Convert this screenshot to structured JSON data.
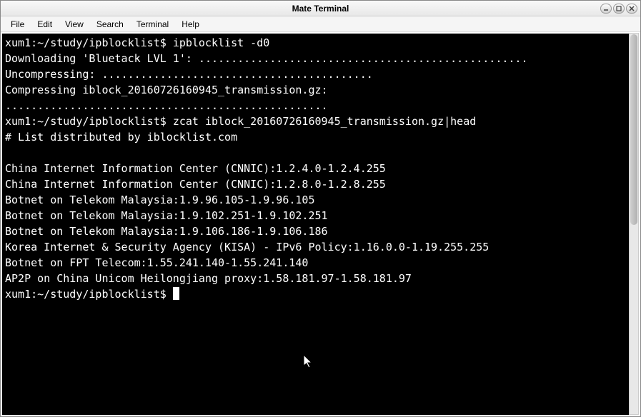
{
  "window": {
    "title": "Mate Terminal"
  },
  "menu": {
    "file": "File",
    "edit": "Edit",
    "view": "View",
    "search": "Search",
    "terminal": "Terminal",
    "help": "Help"
  },
  "terminal": {
    "prompt1": "xum1:~/study/ipblocklist$ ",
    "cmd1": "ipblocklist -d0",
    "line_download": "Downloading 'Bluetack LVL 1': ...................................................",
    "line_uncompress": "Uncompressing: ..........................................",
    "line_compress": "Compressing iblock_20160726160945_transmission.gz: ..................................................",
    "prompt2": "xum1:~/study/ipblocklist$ ",
    "cmd2": "zcat iblock_20160726160945_transmission.gz|head",
    "out1": "# List distributed by iblocklist.com",
    "out2": "",
    "out3": "China Internet Information Center (CNNIC):1.2.4.0-1.2.4.255",
    "out4": "China Internet Information Center (CNNIC):1.2.8.0-1.2.8.255",
    "out5": "Botnet on Telekom Malaysia:1.9.96.105-1.9.96.105",
    "out6": "Botnet on Telekom Malaysia:1.9.102.251-1.9.102.251",
    "out7": "Botnet on Telekom Malaysia:1.9.106.186-1.9.106.186",
    "out8": "Korea Internet & Security Agency (KISA) - IPv6 Policy:1.16.0.0-1.19.255.255",
    "out9": "Botnet on FPT Telecom:1.55.241.140-1.55.241.140",
    "out10": "AP2P on China Unicom Heilongjiang proxy:1.58.181.97-1.58.181.97",
    "prompt3": "xum1:~/study/ipblocklist$ "
  }
}
